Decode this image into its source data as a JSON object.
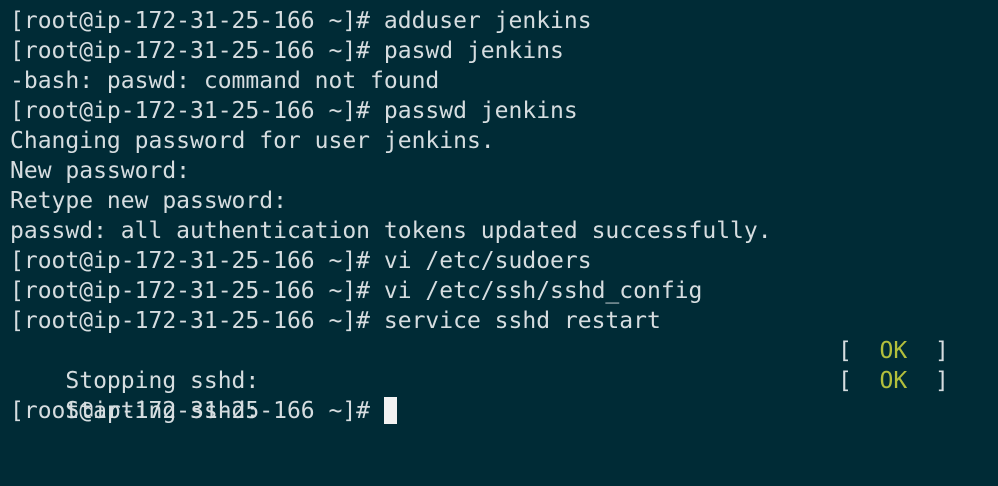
{
  "terminal": {
    "lines": [
      {
        "text": "[root@ip-172-31-25-166 ~]# adduser jenkins"
      },
      {
        "text": "[root@ip-172-31-25-166 ~]# paswd jenkins"
      },
      {
        "text": "-bash: paswd: command not found"
      },
      {
        "text": "[root@ip-172-31-25-166 ~]# passwd jenkins"
      },
      {
        "text": "Changing password for user jenkins."
      },
      {
        "text": "New password:"
      },
      {
        "text": "Retype new password:"
      },
      {
        "text": "passwd: all authentication tokens updated successfully."
      },
      {
        "text": "[root@ip-172-31-25-166 ~]# vi /etc/sudoers"
      },
      {
        "text": "[root@ip-172-31-25-166 ~]# vi /etc/ssh/sshd_config"
      },
      {
        "text": "[root@ip-172-31-25-166 ~]# service sshd restart"
      },
      {
        "text": "Stopping sshd:",
        "status_open": "[  ",
        "status": "OK",
        "status_close": "  ]"
      },
      {
        "text": "Starting sshd:",
        "status_open": "[  ",
        "status": "OK",
        "status_close": "  ]"
      }
    ],
    "prompt": "[root@ip-172-31-25-166 ~]# ",
    "colors": {
      "background": "#002b36",
      "foreground": "#d6dde0",
      "ok": "#b3bf3c",
      "cursor": "#f2f2f2"
    }
  }
}
